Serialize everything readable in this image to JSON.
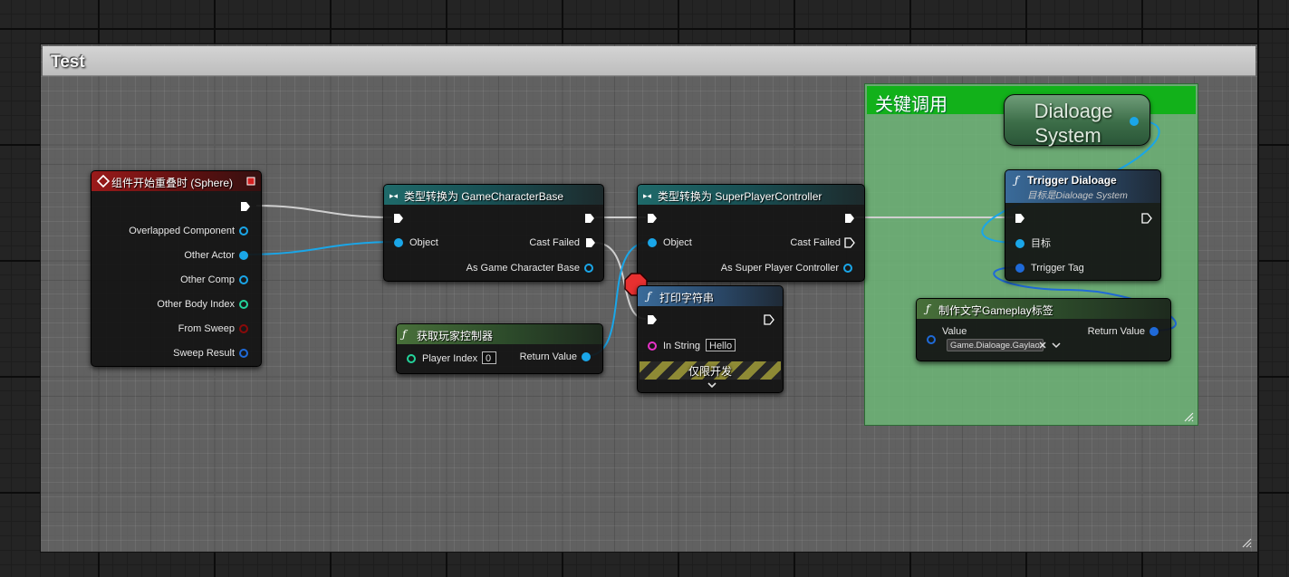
{
  "comment": {
    "title": "Test"
  },
  "inner_comment": {
    "title": "关键调用"
  },
  "variable_node": {
    "label_line1": "Dialoage",
    "label_line2": "System"
  },
  "nodes": {
    "event": {
      "title": "组件开始重叠时 (Sphere)",
      "pins": [
        "Overlapped Component",
        "Other Actor",
        "Other Comp",
        "Other Body Index",
        "From Sweep",
        "Sweep Result"
      ]
    },
    "cast_character": {
      "title": "类型转换为 GameCharacterBase",
      "object_label": "Object",
      "cast_failed_label": "Cast Failed",
      "as_label": "As Game Character Base"
    },
    "get_controller": {
      "title": "获取玩家控制器",
      "player_index_label": "Player Index",
      "player_index_value": "0",
      "return_label": "Return Value"
    },
    "cast_controller": {
      "title": "类型转换为 SuperPlayerController",
      "object_label": "Object",
      "cast_failed_label": "Cast Failed",
      "as_label": "As Super Player Controller"
    },
    "print_string": {
      "title": "打印字符串",
      "in_string_label": "In String",
      "in_string_value": "Hello",
      "dev_only_label": "仅限开发"
    },
    "trigger": {
      "title": "Trrigger Dialoage",
      "subtitle": "目标是Dialoage System",
      "target_label": "目标",
      "tag_label": "Trrigger Tag"
    },
    "make_tag": {
      "title": "制作文字Gameplay标签",
      "value_label": "Value",
      "tag_value": "Game.Dialoage.Gaylao",
      "return_label": "Return Value"
    }
  },
  "colors": {
    "exec_wire": "#cfcfcf",
    "object_pin": "#1aa6e8",
    "struct_pin": "#1f6ad8",
    "int_pin": "#23d39a",
    "bool_pin": "#8a0a0a",
    "string_pin": "#e832c8",
    "event_header": "#9a1a1a",
    "cast_header": "#1f6a6a",
    "pure_header": "#48703a",
    "function_header": "#3a6b9a",
    "inner_comment": "#12b11a"
  }
}
